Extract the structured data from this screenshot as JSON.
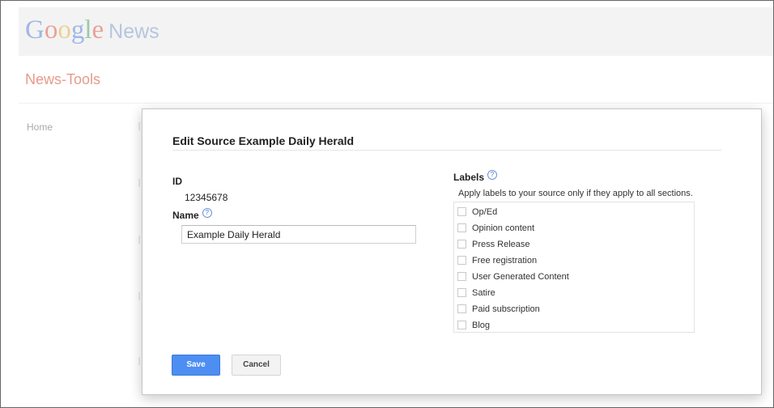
{
  "header": {
    "logo_text": "Google",
    "product": "News",
    "subtitle": "News-Tools"
  },
  "sidebar": {
    "items": [
      {
        "label": "Home"
      }
    ]
  },
  "dialog": {
    "title": "Edit Source Example Daily Herald",
    "id_label": "ID",
    "id_value": "12345678",
    "name_label": "Name",
    "name_value": "Example Daily Herald",
    "labels_title": "Labels",
    "labels_description": "Apply labels to your source only if they apply to all sections.",
    "labels": [
      {
        "label": "Op/Ed",
        "checked": false
      },
      {
        "label": "Opinion content",
        "checked": false
      },
      {
        "label": "Press Release",
        "checked": false
      },
      {
        "label": "Free registration",
        "checked": false
      },
      {
        "label": "User Generated Content",
        "checked": false
      },
      {
        "label": "Satire",
        "checked": false
      },
      {
        "label": "Paid subscription",
        "checked": false
      },
      {
        "label": "Blog",
        "checked": false
      }
    ],
    "help_icon_glyph": "?",
    "save_label": "Save",
    "cancel_label": "Cancel"
  },
  "colors": {
    "save_button": "#4d8ef3",
    "subtitle": "#e79a8a"
  }
}
